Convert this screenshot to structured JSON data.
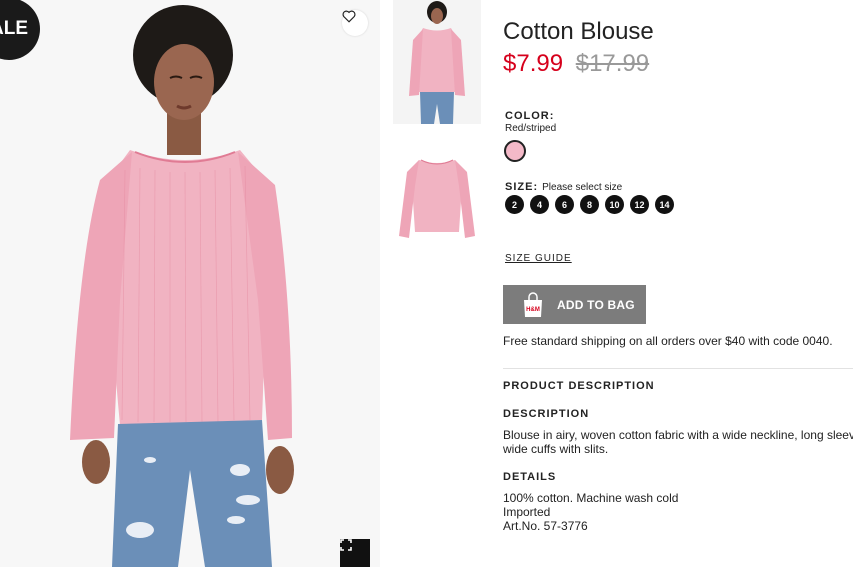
{
  "badge": {
    "label": "ALE"
  },
  "product": {
    "title": "Cotton Blouse",
    "price": "$7.99",
    "old_price": "$17.99"
  },
  "color": {
    "label": "COLOR:",
    "value": "Red/striped",
    "swatch_hex": "#f4b9c8"
  },
  "size": {
    "label": "SIZE:",
    "hint": "Please select size",
    "options": [
      "2",
      "4",
      "6",
      "8",
      "10",
      "12",
      "14"
    ]
  },
  "size_guide": "SIZE GUIDE",
  "add_to_bag": {
    "label": "ADD TO BAG",
    "brand": "H&M"
  },
  "shipping": "Free standard shipping on all orders over $40 with code 0040.",
  "description": {
    "section_title": "PRODUCT DESCRIPTION",
    "heading": "DESCRIPTION",
    "lines": [
      "Blouse in airy, woven cotton fabric with a wide neckline, long sleev",
      "wide cuffs with slits."
    ]
  },
  "details": {
    "heading": "DETAILS",
    "lines": [
      "100% cotton. Machine wash cold",
      "Imported",
      "Art.No. 57-3776"
    ]
  },
  "colors": {
    "sale_red": "#d6001c",
    "button_grey": "#7c7c7c",
    "blouse_pink": "#f1b3c2"
  }
}
